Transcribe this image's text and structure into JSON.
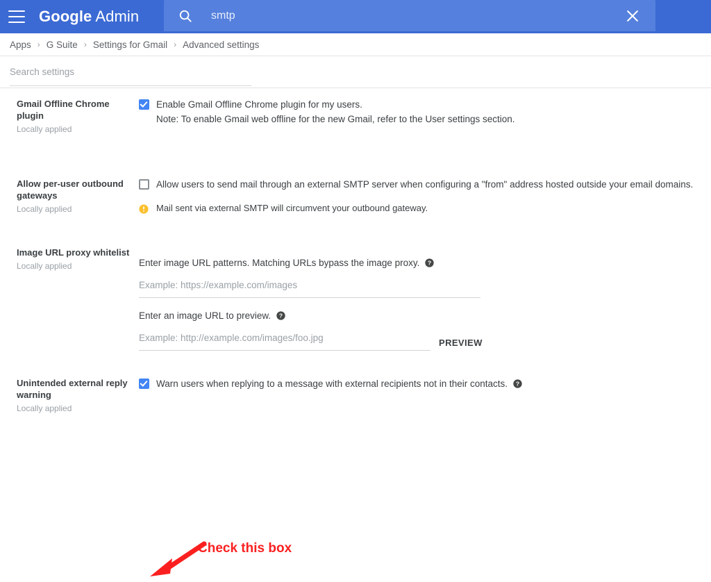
{
  "appbar": {
    "menu_icon": "hamburger-menu-icon",
    "brand_bold": "Google",
    "brand_light": "Admin",
    "search_icon": "search-icon",
    "search_value": "smtp",
    "close_icon": "close-icon",
    "bg_color": "#3c6ad4",
    "search_bg_color": "#5580dd"
  },
  "breadcrumb": {
    "items": [
      "Apps",
      "G Suite",
      "Settings for Gmail",
      "Advanced settings"
    ],
    "separator": "›"
  },
  "search_settings": {
    "placeholder": "Search settings",
    "value": ""
  },
  "sections": [
    {
      "title": "Gmail Offline Chrome plugin",
      "subtitle": "Locally applied",
      "checkbox_checked": true,
      "checkbox_label": "Enable Gmail Offline Chrome plugin for my users.",
      "note": "Note: To enable Gmail web offline for the new Gmail, refer to the User settings section."
    },
    {
      "title": "Allow per-user outbound gateways",
      "subtitle": "Locally applied",
      "checkbox_checked": false,
      "checkbox_label": "Allow users to send mail through an external SMTP server when configuring a \"from\" address hosted outside your email domains.",
      "warning_icon": "warning-icon",
      "warning_text": "Mail sent via external SMTP will circumvent your outbound gateway."
    },
    {
      "title": "Image URL proxy whitelist",
      "subtitle": "Locally applied",
      "field1_label": "Enter image URL patterns. Matching URLs bypass the image proxy.",
      "field1_placeholder": "Example: https://example.com/images",
      "field1_value": "",
      "field2_label": "Enter an image URL to preview.",
      "field2_placeholder": "Example: http://example.com/images/foo.jpg",
      "field2_value": "",
      "preview_button": "PREVIEW",
      "help_icon": "help-circle-icon"
    },
    {
      "title": "Unintended external reply warning",
      "subtitle": "Locally applied",
      "checkbox_checked": true,
      "checkbox_label": "Warn users when replying to a message with external recipients not in their contacts.",
      "help_icon": "help-circle-icon"
    }
  ],
  "annotation": {
    "text": "Check this box",
    "color": "#fb2020",
    "arrow_icon": "red-arrow-icon"
  }
}
